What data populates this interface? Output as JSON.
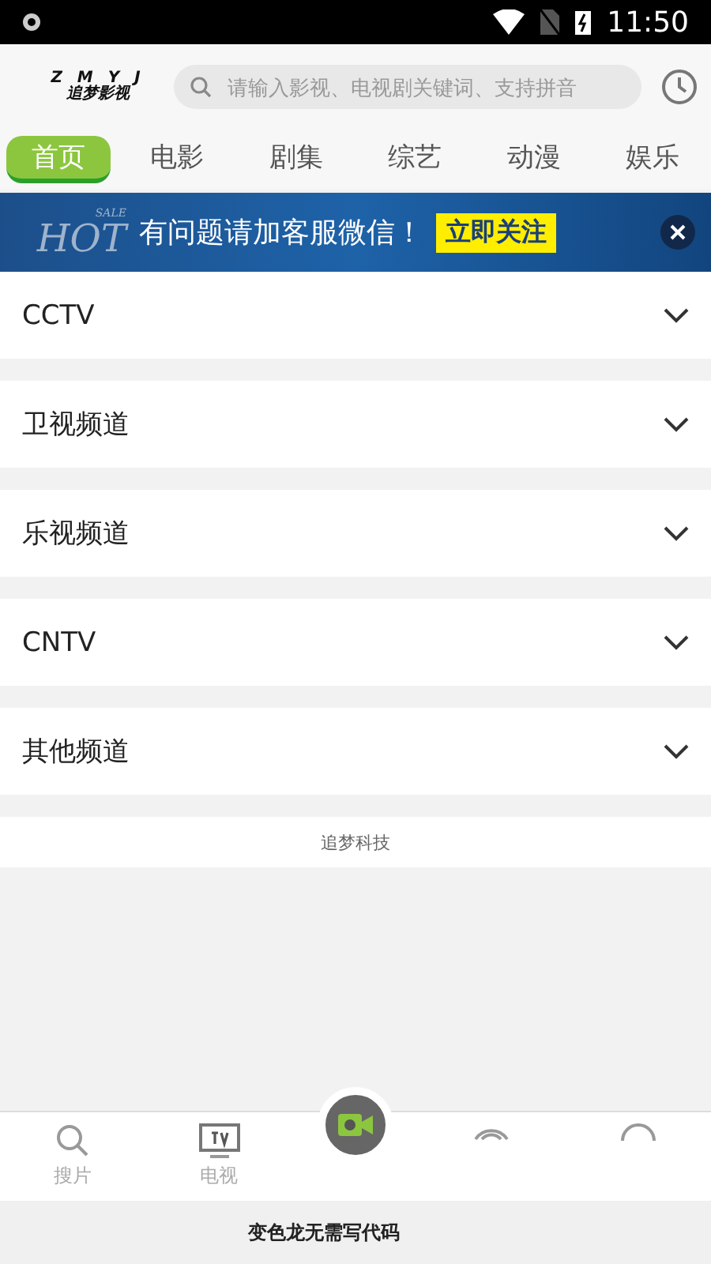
{
  "status_bar": {
    "time": "11:50"
  },
  "header": {
    "logo_top": "Z M Y J",
    "logo_bottom": "追梦影视",
    "search": {
      "placeholder": "请输入影视、电视剧关键词、支持拼音"
    }
  },
  "tabs": [
    {
      "label": "首页",
      "selected": true
    },
    {
      "label": "电影",
      "selected": false
    },
    {
      "label": "剧集",
      "selected": false
    },
    {
      "label": "综艺",
      "selected": false
    },
    {
      "label": "动漫",
      "selected": false
    },
    {
      "label": "娱乐",
      "selected": false
    }
  ],
  "banner": {
    "badge_small": "SALE",
    "badge_big": "HOT",
    "text": "有问题请加客服微信！",
    "action": "立即关注"
  },
  "channel_groups": [
    {
      "label": "CCTV",
      "expanded": false
    },
    {
      "label": "卫视频道",
      "expanded": false
    },
    {
      "label": "乐视频道",
      "expanded": false
    },
    {
      "label": "CNTV",
      "expanded": false
    },
    {
      "label": "其他频道",
      "expanded": false
    }
  ],
  "footer": "追梦科技",
  "bottom_nav": [
    {
      "kind": "search",
      "label": "搜片"
    },
    {
      "kind": "tv",
      "label": "电视"
    },
    {
      "kind": "video",
      "selected": true
    },
    {
      "kind": "signal"
    },
    {
      "kind": "user"
    }
  ],
  "notice": "变色龙无需写代码"
}
